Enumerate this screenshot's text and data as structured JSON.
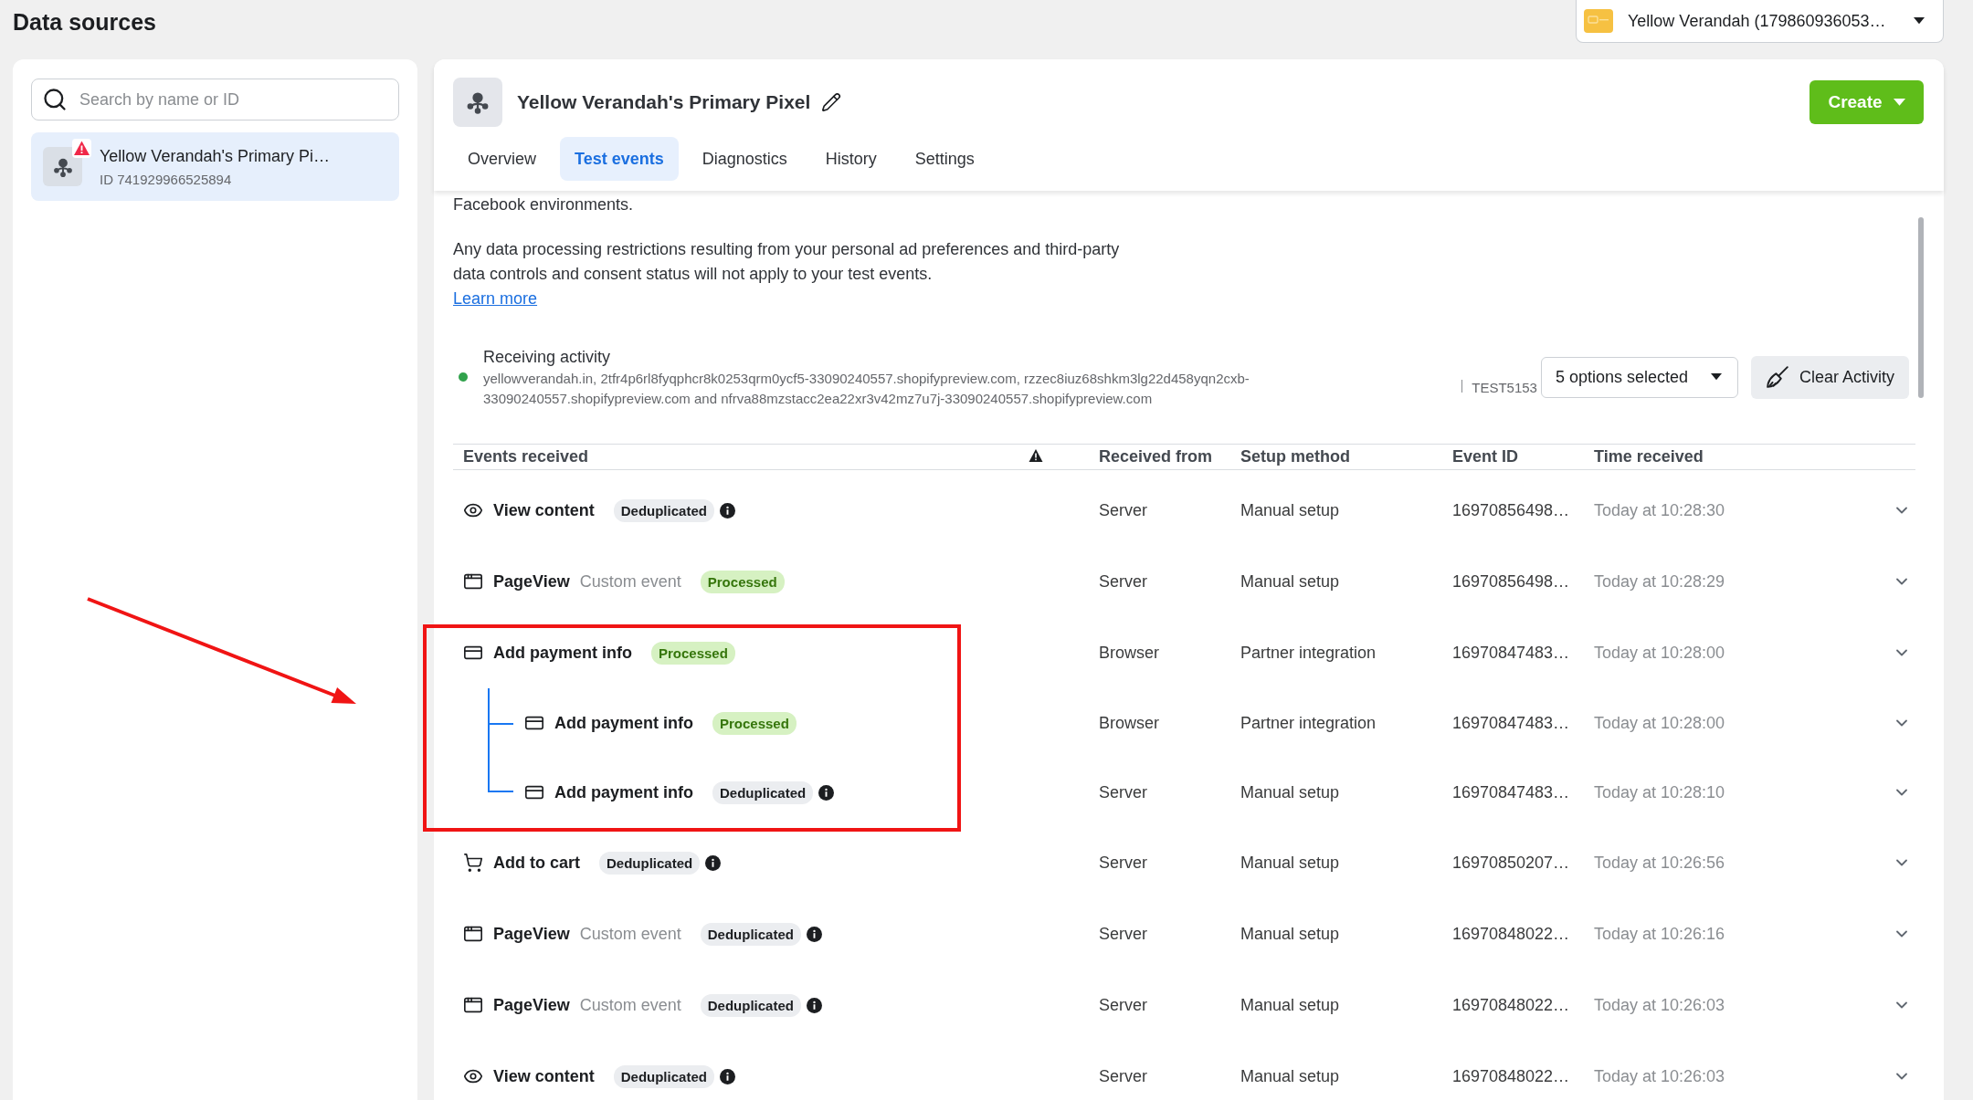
{
  "page_title": "Data sources",
  "account_selector": {
    "label": "Yellow Verandah (179860936053…"
  },
  "sidebar": {
    "search": {
      "placeholder": "Search by name or ID"
    },
    "items": [
      {
        "name": "Yellow Verandah's Primary Pi…",
        "id": "ID 741929966525894",
        "selected": true,
        "warning": true
      }
    ]
  },
  "pixel": {
    "title": "Yellow Verandah's Primary Pixel",
    "create_button": "Create"
  },
  "tabs": [
    {
      "label": "Overview",
      "selected": false
    },
    {
      "label": "Test events",
      "selected": true
    },
    {
      "label": "Diagnostics",
      "selected": false
    },
    {
      "label": "History",
      "selected": false
    },
    {
      "label": "Settings",
      "selected": false
    }
  ],
  "notice": {
    "clipped_line": "Facebook environments.",
    "text": "Any data processing restrictions resulting from your personal ad preferences and third-party data controls and consent status will not apply to your test events.",
    "link": "Learn more"
  },
  "activity": {
    "status": "Receiving activity",
    "active": true,
    "domains": "yellowverandah.in, 2tfr4p6rl8fyqphcr8k0253qrm0ycf5-33090240557.shopifypreview.com, rzzec8iuz68shkm3lg22d458yqn2cxb-33090240557.shopifypreview.com and nfrva88mzstacc2ea22xr3v42mz7u7j-33090240557.shopifypreview.com",
    "test_code": "TEST5153",
    "filter": "5 options selected",
    "clear_button": "Clear Activity"
  },
  "table": {
    "columns": [
      {
        "kind": "text",
        "label": "Events received"
      },
      {
        "kind": "warning"
      },
      {
        "kind": "text",
        "label": "Received from"
      },
      {
        "kind": "text",
        "label": "Setup method"
      },
      {
        "kind": "text",
        "label": "Event ID"
      },
      {
        "kind": "text",
        "label": "Time received"
      }
    ],
    "rows": [
      {
        "kind": "view",
        "event": "View content",
        "badge": {
          "kind": "deduplicated",
          "label": "Deduplicated"
        },
        "received_from": "Server",
        "setup_method": "Manual setup",
        "event_id": "16970856498…",
        "time": "Today at 10:28:30",
        "highlighted": false
      },
      {
        "kind": "page",
        "event": "PageView",
        "type_label": "Custom event",
        "badge": {
          "kind": "processed",
          "label": "Processed"
        },
        "received_from": "Server",
        "setup_method": "Manual setup",
        "event_id": "16970856498…",
        "time": "Today at 10:28:29",
        "highlighted": false
      },
      {
        "kind": "payment",
        "event": "Add payment info",
        "badge": {
          "kind": "processed",
          "label": "Processed"
        },
        "received_from": "Browser",
        "setup_method": "Partner integration",
        "event_id": "16970847483…",
        "time": "Today at 10:28:00",
        "highlighted": true,
        "children": [
          {
            "kind": "payment",
            "event": "Add payment info",
            "badge": {
              "kind": "processed",
              "label": "Processed"
            },
            "received_from": "Browser",
            "setup_method": "Partner integration",
            "event_id": "16970847483…",
            "time": "Today at 10:28:00"
          },
          {
            "kind": "payment",
            "event": "Add payment info",
            "badge": {
              "kind": "deduplicated",
              "label": "Deduplicated"
            },
            "received_from": "Server",
            "setup_method": "Manual setup",
            "event_id": "16970847483…",
            "time": "Today at 10:28:10"
          }
        ]
      },
      {
        "kind": "cart",
        "event": "Add to cart",
        "badge": {
          "kind": "deduplicated",
          "label": "Deduplicated"
        },
        "received_from": "Server",
        "setup_method": "Manual setup",
        "event_id": "16970850207…",
        "time": "Today at 10:26:56",
        "highlighted": false
      },
      {
        "kind": "page",
        "event": "PageView",
        "type_label": "Custom event",
        "badge": {
          "kind": "deduplicated",
          "label": "Deduplicated"
        },
        "received_from": "Server",
        "setup_method": "Manual setup",
        "event_id": "16970848022…",
        "time": "Today at 10:26:16",
        "highlighted": false
      },
      {
        "kind": "page",
        "event": "PageView",
        "type_label": "Custom event",
        "badge": {
          "kind": "deduplicated",
          "label": "Deduplicated"
        },
        "received_from": "Server",
        "setup_method": "Manual setup",
        "event_id": "16970848022…",
        "time": "Today at 10:26:03",
        "highlighted": false
      },
      {
        "kind": "view",
        "event": "View content",
        "badge": {
          "kind": "deduplicated",
          "label": "Deduplicated"
        },
        "received_from": "Server",
        "setup_method": "Manual setup",
        "event_id": "16970848022…",
        "time": "Today at 10:26:03",
        "highlighted": false
      }
    ]
  }
}
